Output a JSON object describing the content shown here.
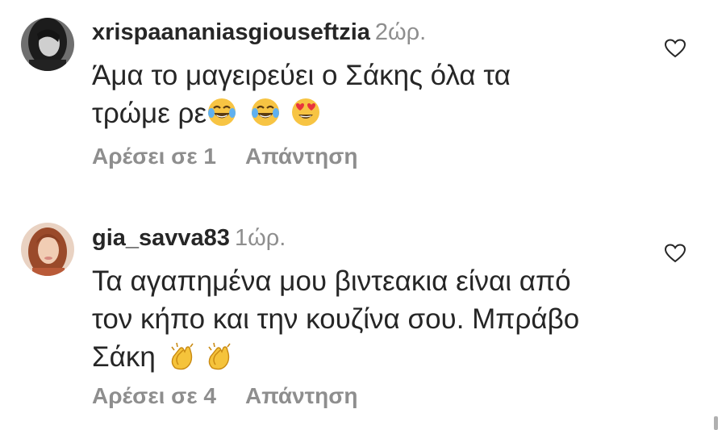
{
  "comments": [
    {
      "username": "xrispaananiasgiouseftzia",
      "time": "2ώρ.",
      "text_line1": "Άμα το μαγειρεύει ο Σάκης όλα τα",
      "text_line2": "τρώμε ρε",
      "emojis": [
        "tears-of-joy-emoji",
        "tears-of-joy-emoji",
        "heart-eyes-emoji"
      ],
      "likes_label": "Αρέσει σε 1",
      "reply_label": "Απάντηση"
    },
    {
      "username": "gia_savva83",
      "time": "1ώρ.",
      "text_line1": "Τα αγαπημένα μου βιντεακια είναι από",
      "text_line2": "τον κήπο και την κουζίνα σου. Μπράβο",
      "text_line3": "Σάκη",
      "emojis": [
        "clapping-hands-emoji",
        "clapping-hands-emoji"
      ],
      "likes_label": "Αρέσει σε 4",
      "reply_label": "Απάντηση"
    }
  ],
  "colors": {
    "text": "#262626",
    "secondary": "#8e8e8e",
    "background": "#ffffff"
  }
}
